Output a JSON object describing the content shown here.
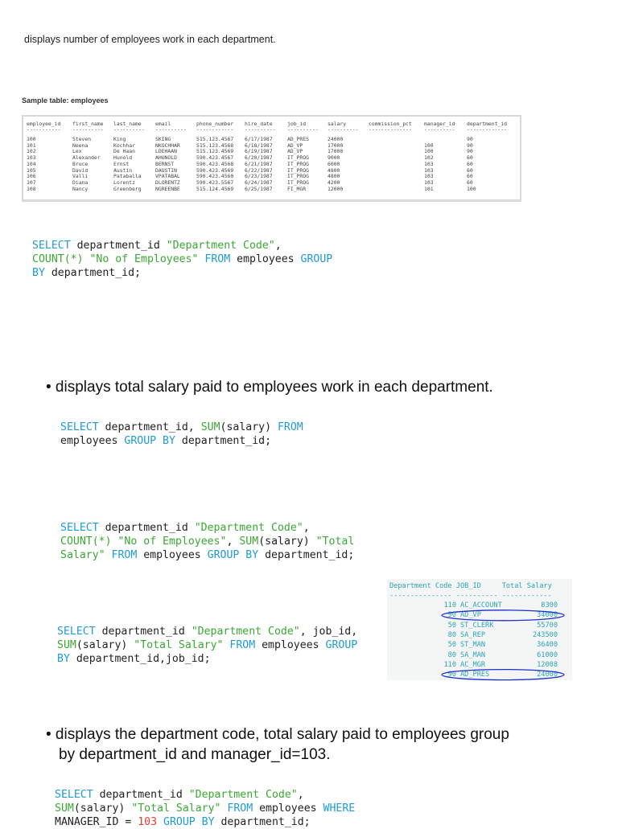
{
  "intro_text": "displays number of employees work in each department.",
  "sample_caption": "Sample table: employees",
  "employees_table": {
    "columns": [
      "employee_id",
      "first_name",
      "last_name",
      "email",
      "phone_number",
      "hire_date",
      "job_id",
      "salary",
      "commission_pct",
      "manager_id",
      "department_id"
    ],
    "separators": [
      "-----------",
      "----------",
      "----------",
      "----------",
      "------------",
      "----------",
      "----------",
      "----------",
      "--------------",
      "----------",
      "-------------"
    ],
    "rows": [
      [
        "100",
        "Steven",
        "King",
        "SKING",
        "515.123.4567",
        "6/17/1987",
        "AD_PRES",
        "24000",
        "",
        "",
        "90"
      ],
      [
        "101",
        "Neena",
        "Kochhar",
        "NKOCHHAR",
        "515.123.4568",
        "6/18/1987",
        "AD_VP",
        "17000",
        "",
        "100",
        "90"
      ],
      [
        "102",
        "Lex",
        "De Haan",
        "LDEHAAN",
        "515.123.4569",
        "6/19/1987",
        "AD_VP",
        "17000",
        "",
        "100",
        "90"
      ],
      [
        "103",
        "Alexander",
        "Hunold",
        "AHUNOLD",
        "590.423.4567",
        "6/20/1987",
        "IT_PROG",
        "9000",
        "",
        "102",
        "60"
      ],
      [
        "104",
        "Bruce",
        "Ernst",
        "BERNST",
        "590.423.4568",
        "6/21/1987",
        "IT_PROG",
        "6000",
        "",
        "103",
        "60"
      ],
      [
        "105",
        "David",
        "Austin",
        "DAUSTIN",
        "590.423.4569",
        "6/22/1987",
        "IT_PROG",
        "4800",
        "",
        "103",
        "60"
      ],
      [
        "106",
        "Valli",
        "Pataballa",
        "VPATABAL",
        "590.423.4560",
        "6/23/1987",
        "IT_PROG",
        "4800",
        "",
        "103",
        "60"
      ],
      [
        "107",
        "Diana",
        "Lorentz",
        "DLORENTZ",
        "590.423.5567",
        "6/24/1987",
        "IT_PROG",
        "4200",
        "",
        "103",
        "60"
      ],
      [
        "108",
        "Nancy",
        "Greenberg",
        "NGREENBE",
        "515.124.4569",
        "6/25/1987",
        "FI_MGR",
        "12000",
        "",
        "101",
        "100"
      ]
    ]
  },
  "queries": [
    [
      [
        [
          "kw",
          "SELECT"
        ],
        [
          "t",
          " department_id "
        ],
        [
          "str",
          "\"Department Code\""
        ],
        [
          "t",
          ","
        ]
      ],
      [
        [
          "fn",
          "COUNT(*)"
        ],
        [
          "t",
          " "
        ],
        [
          "str",
          "\"No of Employees\""
        ],
        [
          "t",
          " "
        ],
        [
          "kw",
          "FROM"
        ],
        [
          "t",
          " employees "
        ],
        [
          "kw",
          "GROUP"
        ]
      ],
      [
        [
          "kw",
          "BY"
        ],
        [
          "t",
          " department_id;"
        ]
      ]
    ],
    [
      [
        [
          "kw",
          "SELECT"
        ],
        [
          "t",
          " department_id, "
        ],
        [
          "fn",
          "SUM"
        ],
        [
          "t",
          "(salary) "
        ],
        [
          "kw",
          "FROM"
        ]
      ],
      [
        [
          "t",
          "employees "
        ],
        [
          "kw",
          "GROUP BY"
        ],
        [
          "t",
          " department_id;"
        ]
      ]
    ],
    [
      [
        [
          "kw",
          "SELECT"
        ],
        [
          "t",
          " department_id "
        ],
        [
          "str",
          "\"Department Code\""
        ],
        [
          "t",
          ","
        ]
      ],
      [
        [
          "fn",
          "COUNT(*)"
        ],
        [
          "t",
          " "
        ],
        [
          "str",
          "\"No of Employees\""
        ],
        [
          "t",
          ", "
        ],
        [
          "fn",
          "SUM"
        ],
        [
          "t",
          "(salary) "
        ],
        [
          "str",
          "\"Total"
        ]
      ],
      [
        [
          "str",
          "Salary\""
        ],
        [
          "t",
          " "
        ],
        [
          "kw",
          "FROM"
        ],
        [
          "t",
          " employees "
        ],
        [
          "kw",
          "GROUP BY"
        ],
        [
          "t",
          " department_id;"
        ]
      ]
    ],
    [
      [
        [
          "kw",
          "SELECT"
        ],
        [
          "t",
          " department_id "
        ],
        [
          "str",
          "\"Department Code\""
        ],
        [
          "t",
          ", job_id,"
        ]
      ],
      [
        [
          "fn",
          "SUM"
        ],
        [
          "t",
          "(salary) "
        ],
        [
          "str",
          "\"Total Salary\""
        ],
        [
          "t",
          " "
        ],
        [
          "kw",
          "FROM"
        ],
        [
          "t",
          " employees "
        ],
        [
          "kw",
          "GROUP"
        ]
      ],
      [
        [
          "kw",
          "BY"
        ],
        [
          "t",
          " department_id,job_id;"
        ]
      ]
    ],
    [
      [
        [
          "kw",
          "SELECT"
        ],
        [
          "t",
          " department_id "
        ],
        [
          "str",
          "\"Department Code\""
        ],
        [
          "t",
          ","
        ]
      ],
      [
        [
          "fn",
          "SUM"
        ],
        [
          "t",
          "(salary) "
        ],
        [
          "str",
          "\"Total Salary\""
        ],
        [
          "t",
          " "
        ],
        [
          "kw",
          "FROM"
        ],
        [
          "t",
          " employees "
        ],
        [
          "kw",
          "WHERE"
        ]
      ],
      [
        [
          "t",
          "MANAGER_ID = "
        ],
        [
          "num",
          "103"
        ],
        [
          "t",
          " "
        ],
        [
          "kw",
          "GROUP BY"
        ],
        [
          "t",
          " department_id;"
        ]
      ]
    ]
  ],
  "bullets": [
    "• displays total salary paid to employees work in each department.",
    "• displays the department code, total salary paid to employees group",
    "by department_id and manager_id=103."
  ],
  "result_table": {
    "header": "Department Code JOB_ID     Total Salary",
    "separator": "--------------- ---------- ------------",
    "rows": [
      [
        "110",
        "AC_ACCOUNT",
        "8300"
      ],
      [
        "90",
        "AD_VP",
        "34000"
      ],
      [
        "50",
        "ST_CLERK",
        "55700"
      ],
      [
        "80",
        "SA_REP",
        "243500"
      ],
      [
        "50",
        "ST_MAN",
        "36400"
      ],
      [
        "80",
        "SA_MAN",
        "61000"
      ],
      [
        "110",
        "AC_MGR",
        "12008"
      ],
      [
        "90",
        "AD_PRES",
        "24000"
      ]
    ],
    "circled_rows": [
      1,
      7
    ]
  }
}
